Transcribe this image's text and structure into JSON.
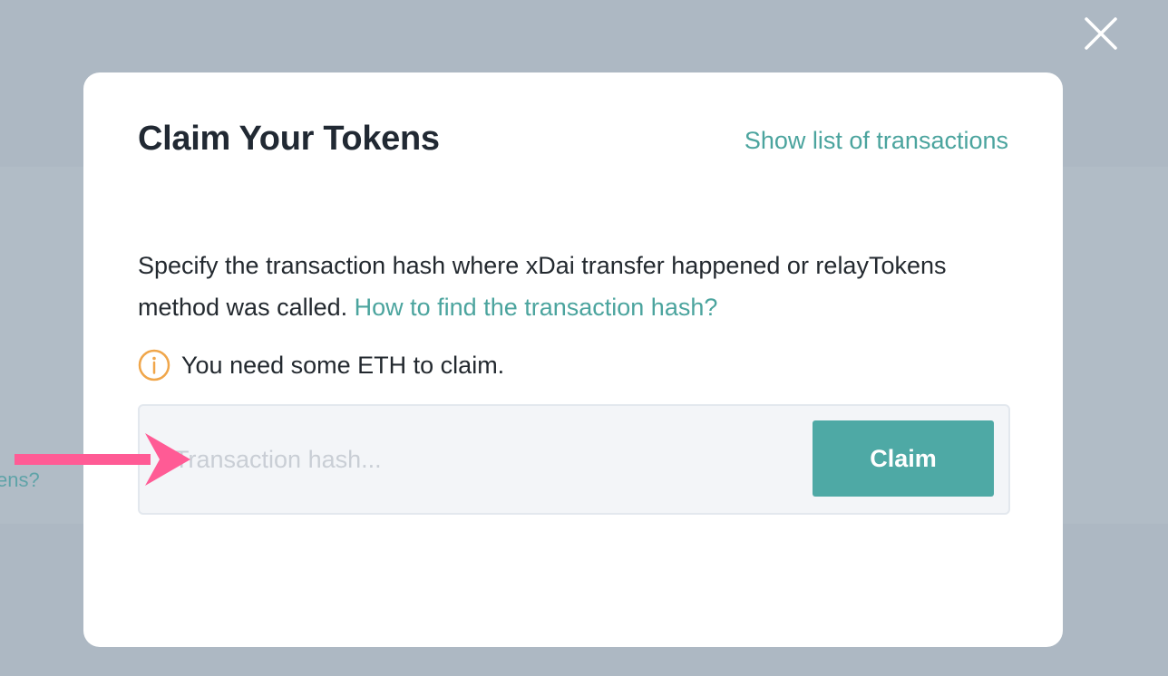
{
  "background": {
    "partial_text": "ens?"
  },
  "modal": {
    "title": "Claim Your Tokens",
    "show_list_link": "Show list of transactions",
    "description_text": "Specify the transaction hash where xDai transfer happened or relayTokens method was called. ",
    "description_link": "How to find the transaction hash?",
    "notice_text": "You need some ETH to claim.",
    "input_placeholder": "Transaction hash...",
    "input_value": "",
    "claim_button": "Claim"
  },
  "icons": {
    "close": "close-icon",
    "info": "info-icon",
    "annotation_arrow": "arrow-right-icon"
  },
  "colors": {
    "overlay": "#adb8c3",
    "accent": "#4ba49e",
    "button": "#4ea9a5",
    "warning": "#f0a64a",
    "annotation_arrow": "#ff5b95",
    "text": "#23292f"
  }
}
